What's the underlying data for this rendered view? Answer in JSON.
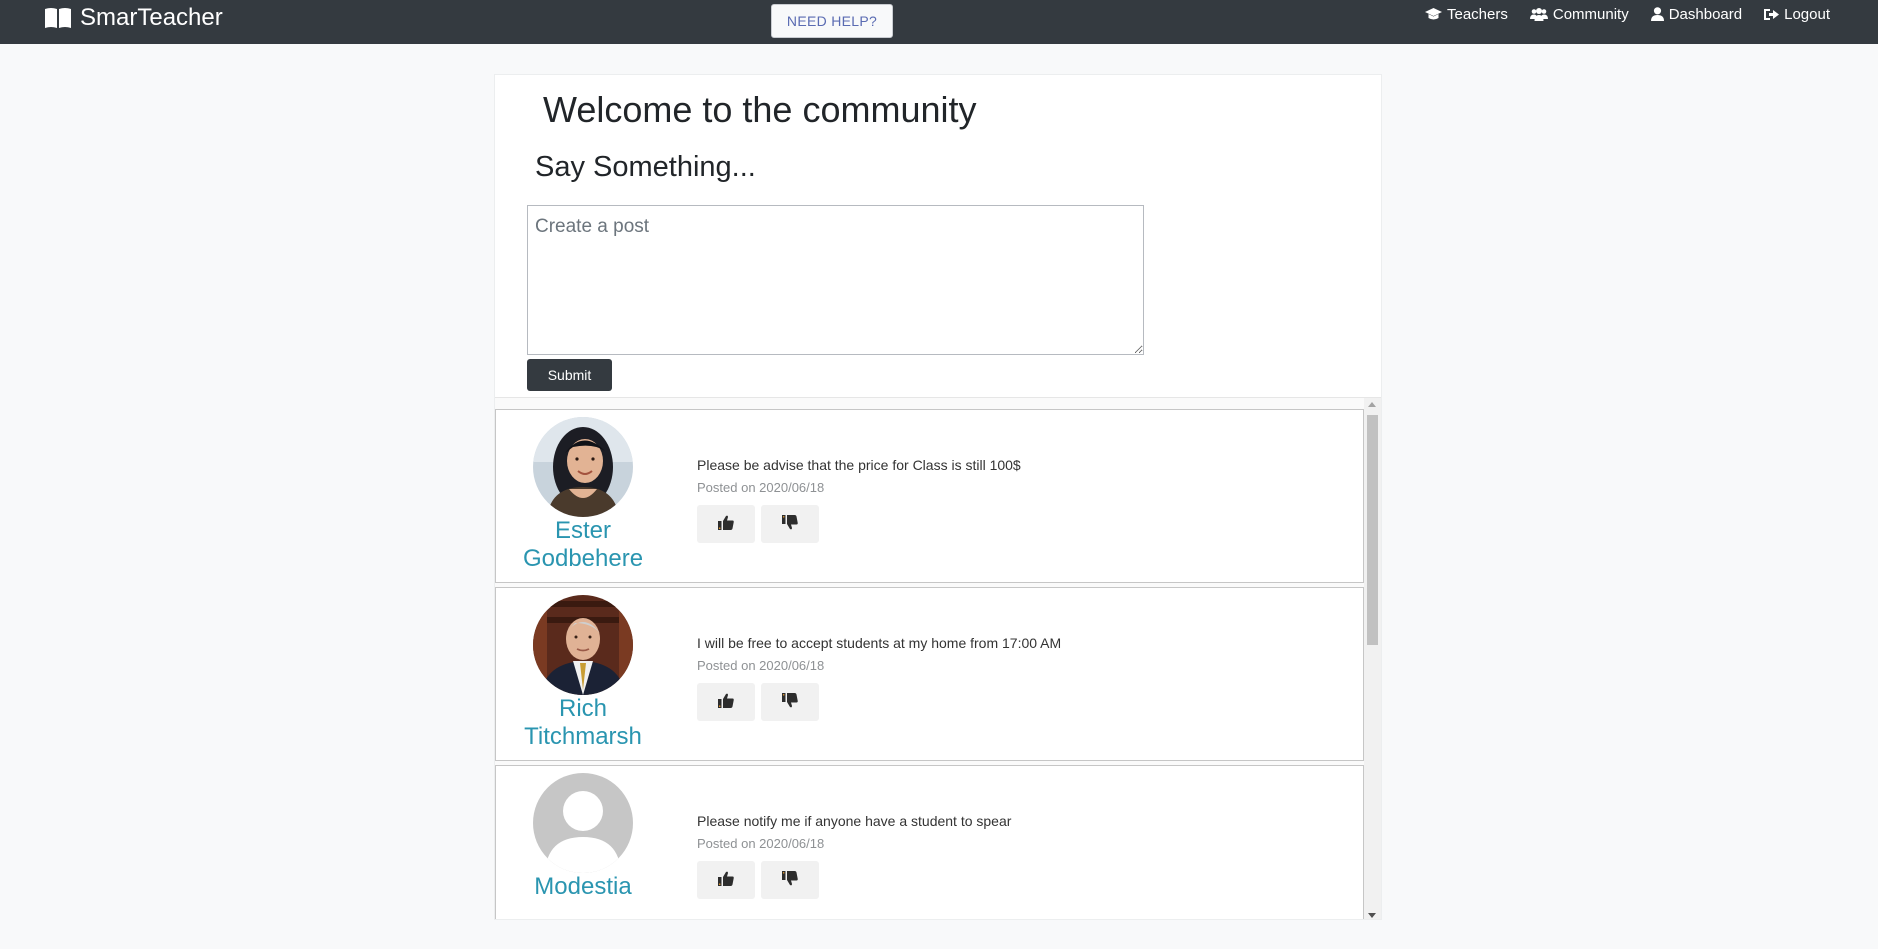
{
  "navbar": {
    "brand": "SmarTeacher",
    "help_label": "NEED HELP?",
    "links": [
      {
        "icon": "graduation-cap-icon",
        "label": "Teachers"
      },
      {
        "icon": "users-icon",
        "label": "Community"
      },
      {
        "icon": "user-icon",
        "label": "Dashboard"
      },
      {
        "icon": "sign-out-icon",
        "label": "Logout"
      }
    ]
  },
  "main": {
    "title": "Welcome to the community",
    "subtitle": "Say Something...",
    "post_placeholder": "Create a post",
    "submit_label": "Submit"
  },
  "posts": [
    {
      "author_first": "Ester",
      "author_last": "Godbehere",
      "avatar": "photo-woman",
      "text": "Please be advise that the price for Class is still 100$",
      "date": "Posted on 2020/06/18"
    },
    {
      "author_first": "Rich",
      "author_last": "Titchmarsh",
      "avatar": "photo-man",
      "text": "I will be free to accept students at my home from 17:00 AM",
      "date": "Posted on 2020/06/18"
    },
    {
      "author_first": "Modestia",
      "author_last": "",
      "avatar": "default-avatar",
      "text": "Please notify me if anyone have a student to spear",
      "date": "Posted on 2020/06/18"
    }
  ],
  "colors": {
    "navbar": "#343a40",
    "author_link": "#2a95b0",
    "help_text": "#5a6bb2",
    "submit": "#343a40"
  }
}
